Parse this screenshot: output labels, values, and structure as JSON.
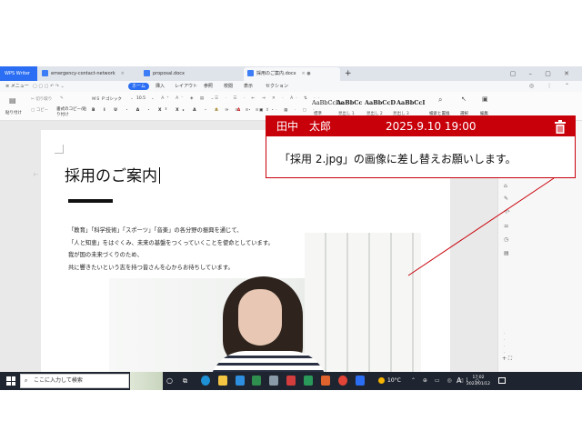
{
  "window": {
    "app_tab": "WPS Writer",
    "tabs": [
      {
        "label": "emergency-contact-network",
        "active": false
      },
      {
        "label": "proposal.docx",
        "active": false
      },
      {
        "label": "採用のご案内.docx",
        "active": true
      }
    ],
    "new_tab_symbol": "+"
  },
  "menubar": {
    "menu_label": "≡ メニュー",
    "items": [
      {
        "label": "ホーム",
        "active": true
      },
      {
        "label": "挿入",
        "active": false
      },
      {
        "label": "レイアウト",
        "active": false
      },
      {
        "label": "参照",
        "active": false
      },
      {
        "label": "校閲",
        "active": false
      },
      {
        "label": "表示",
        "active": false
      },
      {
        "label": "セクション",
        "active": false
      }
    ]
  },
  "ribbon": {
    "paste_label": "貼り付け",
    "cut_label": "切り取り",
    "copy_label": "コピー",
    "format_painter_label": "書式のコピー/貼り付け",
    "font_name": "ＭＳ Ｐゴシック",
    "font_size": "10.5",
    "styles": [
      {
        "sample": "AaBbCcDc",
        "name": "標準"
      },
      {
        "sample": "AaBbCc",
        "name": "見出し 1"
      },
      {
        "sample": "AaBbCcD",
        "name": "見出し 2"
      },
      {
        "sample": "AaBbCcI",
        "name": "見出し 3"
      }
    ],
    "find_replace_label": "検索と置換",
    "select_label": "選択",
    "edit_label": "編集"
  },
  "document": {
    "title": "採用のご案内",
    "paragraphs": [
      "「教育」「科学技術」「スポーツ」「音楽」の各分野の振興を通じて、",
      "「人と知恵」をはぐくみ、未来の基盤をつくっていくことを使命としています。",
      "我が国の未来づくりのため、",
      "共に響きたいという志を持つ皆さんを心からお待ちしています。"
    ]
  },
  "comment": {
    "author": "田中　太郎",
    "datetime": "2025.9.10 19:00",
    "body": "「採用 2.jpg」の画像に差し替えお願いします。",
    "accent_color": "#c8000a"
  },
  "taskbar": {
    "search_placeholder": "ここに入力して検索",
    "weather": "10°C",
    "ime": "A",
    "time": "17:02",
    "date": "2023/01/12"
  }
}
